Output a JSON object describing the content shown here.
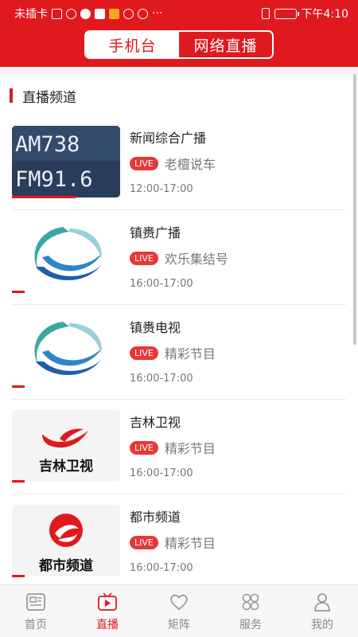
{
  "status_bar": {
    "carrier": "未插卡",
    "time": "下午4:10"
  },
  "segment": {
    "tabs": [
      {
        "label": "手机台",
        "active": true
      },
      {
        "label": "网络直播",
        "active": false
      }
    ]
  },
  "section": {
    "title": "直播频道"
  },
  "live_badge": "LIVE",
  "channels": [
    {
      "name": "新闻综合广播",
      "program": "老檀说车",
      "time": "12:00-17:00",
      "thumb_line1": "AM738",
      "thumb_line2": "FM91.6",
      "icon": "radio-am-fm-logo"
    },
    {
      "name": "镇赉广播",
      "program": "欢乐集结号",
      "time": "16:00-17:00",
      "icon": "zhenlai-swoosh-logo"
    },
    {
      "name": "镇赉电视",
      "program": "精彩节目",
      "time": "16:00-17:00",
      "icon": "zhenlai-swoosh-logo"
    },
    {
      "name": "吉林卫视",
      "program": "精彩节目",
      "time": "16:00-17:00",
      "thumb_text": "吉林卫视",
      "icon": "jilin-tv-logo"
    },
    {
      "name": "都市频道",
      "program": "精彩节目",
      "time": "16:00-17:00",
      "thumb_text": "都市频道",
      "icon": "city-channel-logo"
    }
  ],
  "tabbar": {
    "items": [
      {
        "label": "首页",
        "icon": "news-icon"
      },
      {
        "label": "直播",
        "icon": "live-video-icon"
      },
      {
        "label": "矩阵",
        "icon": "heart-icon"
      },
      {
        "label": "服务",
        "icon": "grid-icon"
      },
      {
        "label": "我的",
        "icon": "person-icon"
      }
    ],
    "active_index": 1
  },
  "colors": {
    "brand_red": "#e0191e",
    "live_red": "#e63737",
    "inactive_tab": "#888888"
  }
}
